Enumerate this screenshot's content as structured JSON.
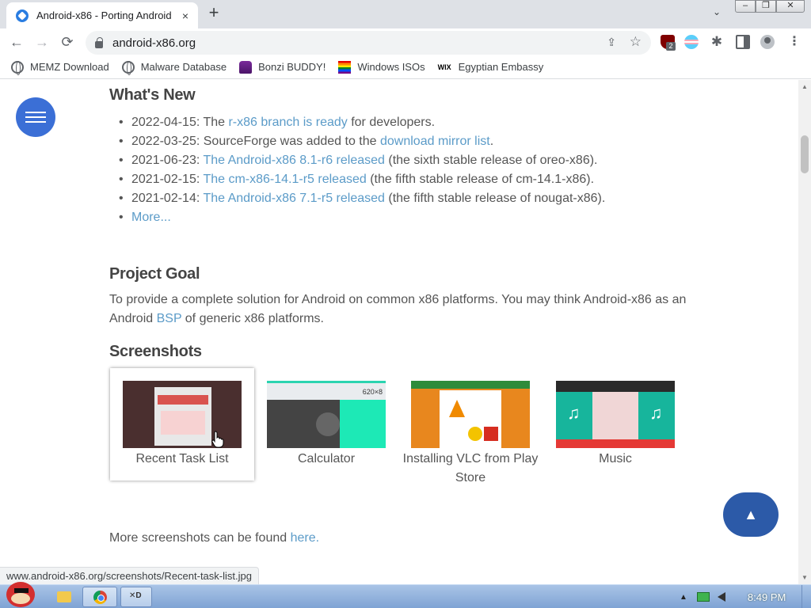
{
  "browser": {
    "tab_title": "Android-x86 - Porting Android",
    "tab_close": "×",
    "new_tab": "+",
    "tab_search": "⌄",
    "window_min": "–",
    "window_max": "❐",
    "window_close": "✕",
    "back": "←",
    "forward": "→",
    "reload": "⟳",
    "url": "android-x86.org",
    "share": "⇪",
    "star": "☆",
    "ublock_badge": "2",
    "extensions": "✱",
    "menu": "⋮",
    "status_url": "www.android-x86.org/screenshots/Recent-task-list.jpg"
  },
  "bookmarks": [
    {
      "label": "MEMZ Download",
      "icon": "globe-icon"
    },
    {
      "label": "Malware Database",
      "icon": "globe-icon"
    },
    {
      "label": "Bonzi BUDDY!",
      "icon": "bonzi-icon"
    },
    {
      "label": "Windows ISOs",
      "icon": "rainbow-flag-icon"
    },
    {
      "label": "Egyptian Embassy",
      "icon": "wix-icon",
      "icon_text": "WIX"
    }
  ],
  "page": {
    "whats_new_heading": "What's New",
    "news": [
      {
        "date": "2022-04-15:",
        "pre": " The ",
        "link": "r-x86 branch is ready",
        "post": " for developers."
      },
      {
        "date": "2022-03-25:",
        "pre": " SourceForge was added to the ",
        "link": "download mirror list",
        "post": "."
      },
      {
        "date": "2021-06-23:",
        "pre": " ",
        "link": "The Android-x86 8.1-r6 released",
        "post": " (the sixth stable release of oreo-x86)."
      },
      {
        "date": "2021-02-15:",
        "pre": " ",
        "link": "The cm-x86-14.1-r5 released",
        "post": " (the fifth stable release of cm-14.1-x86)."
      },
      {
        "date": "2021-02-14:",
        "pre": " ",
        "link": "The Android-x86 7.1-r5 released",
        "post": " (the fifth stable release of nougat-x86)."
      }
    ],
    "more_link": "More...",
    "goal_heading": "Project Goal",
    "goal_text_1": "To provide a complete solution for Android on common x86 platforms. You may think Android-x86 as an Android ",
    "goal_link": "BSP",
    "goal_text_2": " of generic x86 platforms.",
    "screenshots_heading": "Screenshots",
    "screenshots": [
      {
        "caption": "Recent Task List"
      },
      {
        "caption": "Calculator",
        "thumb_text": "620×8"
      },
      {
        "caption": "Installing VLC from Play Store"
      },
      {
        "caption": "Music"
      }
    ],
    "more_shots_text": "More screenshots can be found ",
    "more_shots_link": "here.",
    "scroll_top": "▲"
  },
  "taskbar": {
    "clock": "8:49 PM",
    "app_label": "✕D",
    "tray_up": "▲"
  }
}
